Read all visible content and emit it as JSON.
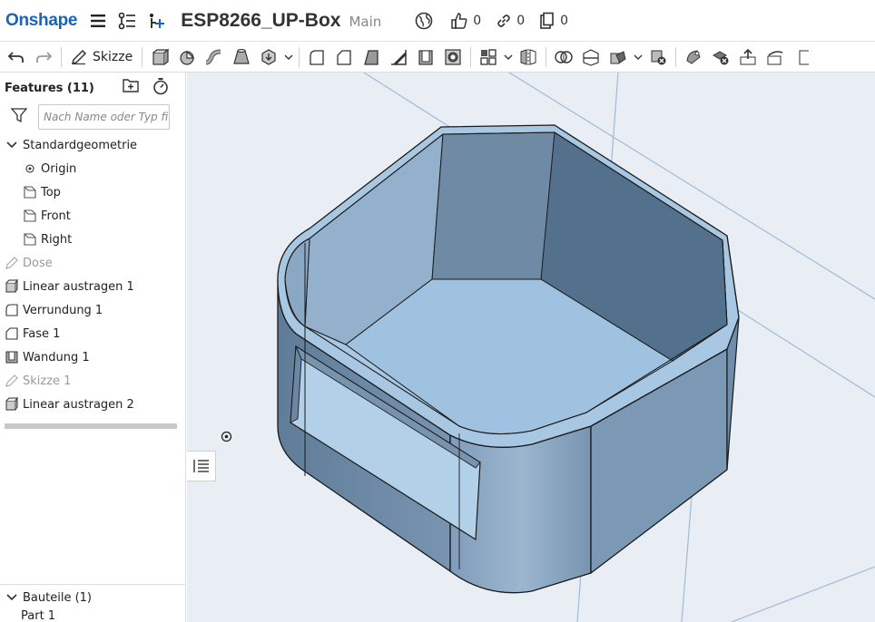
{
  "header": {
    "logo": "Onshape",
    "document_title": "ESP8266_UP-Box",
    "branch": "Main",
    "likes": "0",
    "links": "0",
    "copies": "0"
  },
  "toolbar": {
    "sketch_label": "Skizze"
  },
  "features": {
    "title": "Features (11)",
    "filter_placeholder": "Nach Name oder Typ filtern",
    "items": [
      {
        "label": "Standardgeometrie",
        "icon": "chevron-down-icon"
      },
      {
        "label": "Origin",
        "icon": "origin-icon"
      },
      {
        "label": "Top",
        "icon": "plane-icon"
      },
      {
        "label": "Front",
        "icon": "plane-icon"
      },
      {
        "label": "Right",
        "icon": "plane-icon"
      },
      {
        "label": "Dose",
        "icon": "sketch-icon"
      },
      {
        "label": "Linear austragen 1",
        "icon": "extrude-icon"
      },
      {
        "label": "Verrundung 1",
        "icon": "fillet-icon"
      },
      {
        "label": "Fase 1",
        "icon": "chamfer-icon"
      },
      {
        "label": "Wandung 1",
        "icon": "shell-icon"
      },
      {
        "label": "Skizze 1",
        "icon": "sketch-icon"
      },
      {
        "label": "Linear austragen 2",
        "icon": "extrude-icon"
      }
    ]
  },
  "parts": {
    "title": "Bauteile (1)",
    "items": [
      {
        "label": "Part 1"
      }
    ]
  },
  "colors": {
    "brand": "#1a63b8",
    "model_fill": "#9ec0de",
    "model_dark": "#6d8aa6",
    "viewport_bg": "#e9edf4"
  }
}
